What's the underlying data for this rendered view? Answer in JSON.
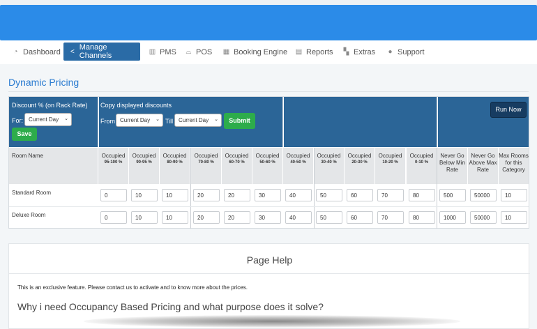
{
  "nav": {
    "items": [
      {
        "label": "Dashboard",
        "icon": "dashboard-icon"
      },
      {
        "label": "Manage Channels",
        "icon": "share-icon"
      },
      {
        "label": "PMS",
        "icon": "building-icon"
      },
      {
        "label": "POS",
        "icon": "cloche-icon"
      },
      {
        "label": "Booking Engine",
        "icon": "calendar-icon"
      },
      {
        "label": "Reports",
        "icon": "clipboard-icon"
      },
      {
        "label": "Extras",
        "icon": "grid-icon"
      },
      {
        "label": "Support",
        "icon": "user-icon"
      }
    ],
    "active_index": 1
  },
  "page": {
    "title": "Dynamic Pricing"
  },
  "controls": {
    "discount_label": "Discount % (on Rack Rate)",
    "for_label": "For:",
    "for_value": "Current Day",
    "save_label": "Save",
    "copy_label": "Copy displayed discounts",
    "from_label": "From",
    "from_value": "Current Day",
    "till_label": "Till",
    "till_value": "Current Day",
    "submit_label": "Submit",
    "run_now_label": "Run Now"
  },
  "table": {
    "room_header": "Room Name",
    "occupancy_headers": [
      {
        "top": "Occupied",
        "range": "95-100 %"
      },
      {
        "top": "Occupied",
        "range": "90-95 %"
      },
      {
        "top": "Occupied",
        "range": "80-90 %"
      },
      {
        "top": "Occupied",
        "range": "70-80 %"
      },
      {
        "top": "Occupied",
        "range": "60-70 %"
      },
      {
        "top": "Occupied",
        "range": "50-60 %"
      },
      {
        "top": "Occupied",
        "range": "40-50 %"
      },
      {
        "top": "Occupied",
        "range": "30-40 %"
      },
      {
        "top": "Occupied",
        "range": "20-30 %"
      },
      {
        "top": "Occupied",
        "range": "10-20 %"
      },
      {
        "top": "Occupied",
        "range": "0-10 %"
      }
    ],
    "extra_headers": [
      "Never Go Below Min Rate",
      "Never Go Above Max Rate",
      "Max Rooms for this Category"
    ],
    "rows": [
      {
        "name": "Standard Room",
        "values": [
          "0",
          "10",
          "10",
          "20",
          "20",
          "30",
          "40",
          "50",
          "60",
          "70",
          "80"
        ],
        "min_rate": "500",
        "max_rate": "50000",
        "max_rooms": "10"
      },
      {
        "name": "Deluxe Room",
        "values": [
          "0",
          "10",
          "10",
          "20",
          "20",
          "30",
          "40",
          "50",
          "60",
          "70",
          "80"
        ],
        "min_rate": "1000",
        "max_rate": "50000",
        "max_rooms": "10"
      }
    ]
  },
  "help": {
    "title": "Page Help",
    "text": "This is an exclusive feature. Please contact us to activate and to know more about the prices.",
    "question": "Why i need Occupancy Based Pricing and what purpose does it solve?"
  }
}
